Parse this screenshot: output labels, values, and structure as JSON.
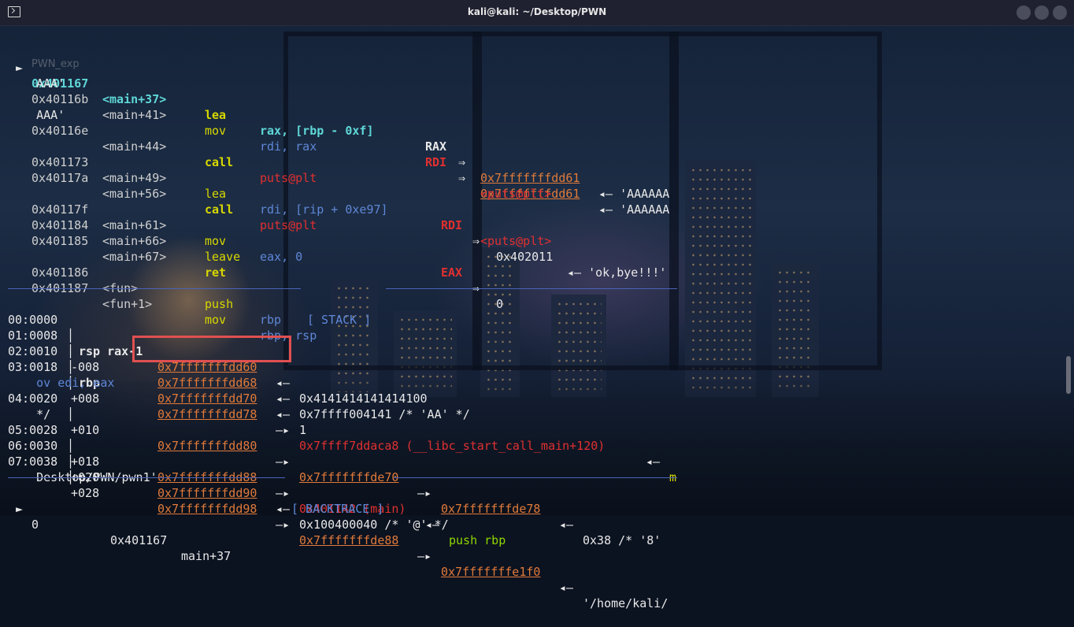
{
  "window": {
    "title": "kali@kali: ~/Desktop/PWN",
    "ghost_label": "PWN_exp"
  },
  "disasm": [
    {
      "arrow": "►",
      "addr": "0x401167",
      "sym": "<main+37>",
      "mnem": "lea",
      "ops": "rax, [rbp - 0xf]",
      "reg": "RAX",
      "eq": "⇒",
      "val": "0x7fffffffdd61",
      "tail": "◂— 'AAAAAA"
    },
    {
      "cont": "AAA'"
    },
    {
      "addr": "0x40116b",
      "sym": "<main+41>",
      "mnem": "mov",
      "ops": "rdi, rax",
      "reg": "RDI",
      "eq": "⇒",
      "val": "0x7fffffffdd61",
      "tail": "◂— 'AAAAAA"
    },
    {
      "cont": "AAA'"
    },
    {
      "addr": "0x40116e",
      "sym": "<main+44>",
      "mnem": "call",
      "target": "puts@plt",
      "right": "<puts@plt>"
    },
    {
      "addr": "0x401173",
      "sym": "<main+49>",
      "mnem": "lea",
      "ops": "rdi, [rip + 0xe97]",
      "reg": "RDI",
      "eq": "⇒",
      "val": "0x402011",
      "tail": "◂— 'ok,bye!!!'"
    },
    {
      "addr": "0x40117a",
      "sym": "<main+56>",
      "mnem": "call",
      "target": "puts@plt",
      "right": "<puts@plt>"
    },
    {
      "addr": "0x40117f",
      "sym": "<main+61>",
      "mnem": "mov",
      "ops": "eax, 0",
      "reg": "EAX",
      "eq": "⇒",
      "val": "0"
    },
    {
      "addr": "0x401184",
      "sym": "<main+66>",
      "mnem": "leave"
    },
    {
      "addr": "0x401185",
      "sym": "<main+67>",
      "mnem": "ret"
    },
    {
      "addr": "0x401186",
      "sym": "<fun>",
      "mnem": "push",
      "ops": "rbp"
    },
    {
      "addr": "0x401187",
      "sym": "<fun+1>",
      "mnem": "mov",
      "ops": "rbp, rsp"
    }
  ],
  "stack": {
    "header": "[ STACK ]",
    "rows": [
      {
        "idx": "00:0000",
        "off": "rsp rax-1",
        "addr": "0x7fffffffdd60",
        "arrow": "◂—",
        "rest": "0x4141414141414100"
      },
      {
        "idx": "01:0008",
        "off": "-008",
        "addr": "0x7fffffffdd68",
        "arrow": "◂—",
        "rest": "0x7ffff004141 /* 'AA' */"
      },
      {
        "idx": "02:0010",
        "off": "rbp",
        "addr": "0x7fffffffdd70",
        "arrow": "◂—",
        "rest": "1"
      },
      {
        "idx": "03:0018",
        "off": "+008",
        "addr": "0x7fffffffdd78",
        "arrow": "—▸",
        "red": "0x7ffff7ddaca8 (__libc_start_call_main+120)",
        "arrow2": "◂—",
        "tail": "m"
      },
      {
        "cont": "ov edi, eax"
      },
      {
        "idx": "04:0020",
        "off": "+010",
        "addr": "0x7fffffffdd80",
        "arrow": "—▸",
        "addr2": "0x7fffffffde70",
        "arrow2": "—▸",
        "addr3": "0x7fffffffde78",
        "arrow3": "◂—",
        "rest": "0x38 /* '8'"
      },
      {
        "cont": "*/"
      },
      {
        "idx": "05:0028",
        "off": "+018",
        "addr": "0x7fffffffdd88",
        "arrow": "—▸",
        "red": "0x401142 (main)",
        "arrow2": "◂—",
        "tail": "push rbp"
      },
      {
        "idx": "06:0030",
        "off": "+020",
        "addr": "0x7fffffffdd90",
        "arrow": "◂—",
        "rest": "0x100400040 /* '@' */"
      },
      {
        "idx": "07:0038",
        "off": "+028",
        "addr": "0x7fffffffdd98",
        "arrow": "—▸",
        "addr2": "0x7fffffffde88",
        "arrow2": "—▸",
        "addr3": "0x7fffffffe1f0",
        "arrow3": "◂—",
        "rest": "'/home/kali/"
      },
      {
        "cont": "Desktop/PWN/pwn1'"
      }
    ]
  },
  "backtrace": {
    "header": "[ BACKTRACE ]",
    "arrow": "►",
    "frame": "0",
    "addr": "0x401167",
    "sym": "main+37"
  },
  "colors": {
    "accent_cyan": "#5fd7d7",
    "mnemonic_yellow": "#d7d700",
    "register_red": "#e03030",
    "operand_blue": "#5f87d7",
    "address_orange": "#e07a3a",
    "separator_blue": "#4a63b8",
    "highlight_box": "#e05050"
  }
}
